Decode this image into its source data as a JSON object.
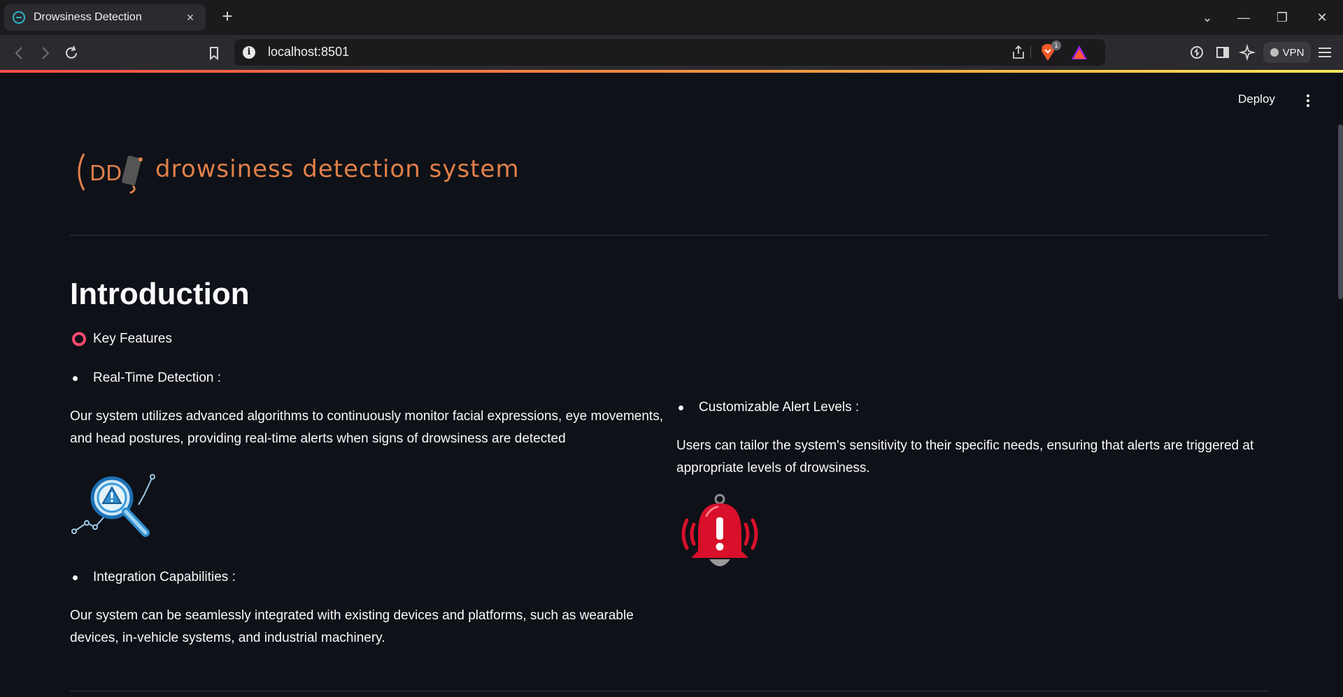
{
  "browser": {
    "tab_title": "Drowsiness Detection",
    "tab_close": "×",
    "new_tab": "+",
    "url": "localhost:8501",
    "brave_badge_count": "1",
    "vpn_label": "VPN",
    "window_controls": {
      "dropdown": "⌄",
      "minimize": "—",
      "restore": "❐",
      "close": "✕"
    }
  },
  "header": {
    "deploy_label": "Deploy"
  },
  "logo": {
    "title": "drowsiness detection system",
    "mark_text": "DD"
  },
  "main": {
    "heading": "Introduction",
    "key_features_label": "Key Features",
    "left": {
      "feature1_title": "Real-Time Detection :",
      "feature1_line1": "Our system utilizes advanced algorithms to continuously monitor facial expressions, eye movements,",
      "feature1_line2": "and head postures, providing real-time alerts when signs of drowsiness are detected",
      "feature3_title": "Integration Capabilities :",
      "feature3_line1": "Our system can be seamlessly integrated with existing devices and platforms, such as wearable",
      "feature3_line2": "devices, in-vehicle systems, and industrial machinery."
    },
    "right": {
      "feature2_title": "Customizable Alert Levels :",
      "feature2_line1": "Users can tailor the system's sensitivity to their specific needs, ensuring that alerts are triggered at",
      "feature2_line2": "appropriate levels of drowsiness."
    }
  },
  "icons": {
    "detection": "magnifier-warning-icon",
    "alert": "alarm-bell-icon"
  },
  "colors": {
    "background": "#0e1117",
    "accent_orange": "#e0804a",
    "ring_red": "#ff4b6e",
    "bell_red": "#d8102a"
  }
}
